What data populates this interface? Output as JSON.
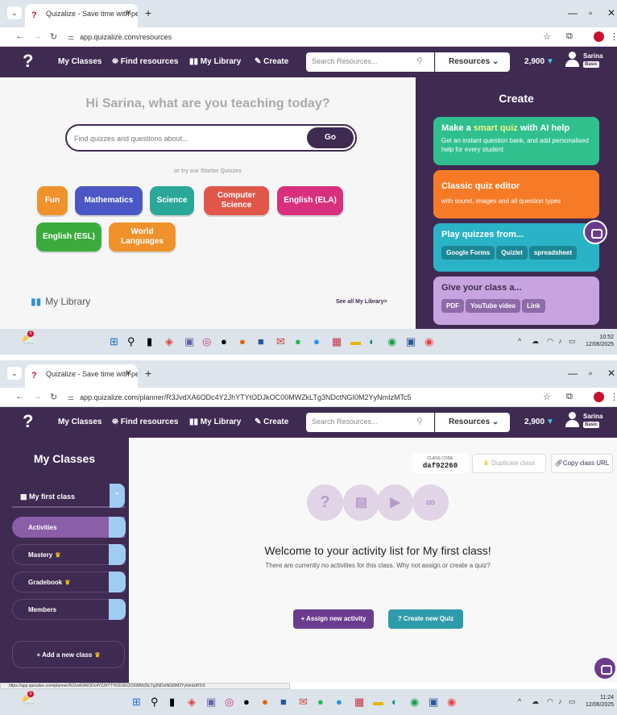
{
  "screen1": {
    "browser": {
      "tab_title": "Quizalize - Save time with pers",
      "url": "app.quizalize.com/resources"
    },
    "nav": {
      "my_classes": "My Classes",
      "find_resources": "Find resources",
      "my_library": "My Library",
      "create": "Create",
      "search_placeholder": "Search Resources...",
      "resources_label": "Resources",
      "points": "2,900",
      "user_name": "Sarina",
      "user_badge": "Basic"
    },
    "main": {
      "greeting": "Hi Sarina, what are you teaching today?",
      "search_placeholder": "Find quizzes and questions about...",
      "go_label": "Go",
      "starter_prompt": "or try our Starter Quizzes",
      "chips": [
        "Fun",
        "Mathematics",
        "Science",
        "Computer Science",
        "English (ELA)",
        "English (ESL)",
        "World Languages"
      ],
      "my_library": "My Library",
      "see_all": "See all My Library>"
    },
    "create_panel": {
      "title": "Create",
      "smart_quiz_pre": "Make a ",
      "smart_quiz_highlight": "smart quiz",
      "smart_quiz_post": " with AI help",
      "smart_quiz_sub": "Get an instant question bank, and add personalised help for every student",
      "classic_title": "Classic quiz editor",
      "classic_sub": "with sound, images and all question types",
      "play_title": "Play quizzes from...",
      "play_pills": [
        "Google Forms",
        "Quizlet",
        "spreadsheet"
      ],
      "give_title": "Give your class a...",
      "give_pills": [
        "PDF",
        "YouTube video",
        "Link"
      ]
    },
    "taskbar": {
      "time": "10:52",
      "date": "12/06/2025",
      "notif": "5"
    }
  },
  "screen2": {
    "browser": {
      "tab_title": "Quizalize - Save time with pers",
      "url": "app.quizalize.com/planner/R3JvdXA6ODc4Y2JhYTYtODJkOC00MWZkLTg3NDctNGI0M2YyNmIzMTc5"
    },
    "nav": {
      "my_classes": "My Classes",
      "find_resources": "Find resources",
      "my_library": "My Library",
      "create": "Create",
      "search_placeholder": "Search Resources...",
      "resources_label": "Resources",
      "points": "2,900",
      "user_name": "Sarina",
      "user_badge": "Basic"
    },
    "sidebar": {
      "title": "My Classes",
      "class_name": "My first class",
      "items": [
        "Activities",
        "Mastery",
        "Gradebook",
        "Members"
      ],
      "add_class": "Add a new class"
    },
    "main": {
      "class_code_label": "CLASS CODE",
      "class_code": "daf92260",
      "duplicate": "Duplicate class",
      "copy_url": "Copy class URL",
      "welcome": "Welcome to your activity list for My first class!",
      "subtext": "There are currently no activities for this class. Why not assign or create a quiz?",
      "assign": "Assign new activity",
      "create_quiz": "Create new Quiz"
    },
    "status_url": "https://app.quizalize.com/planner/R3JvdXA6ODc4Y2JhYTYtODJkOC00MWZkLTg3NDctNGI0M2YyNmIzMTc5",
    "taskbar": {
      "time": "11:24",
      "date": "12/06/2025",
      "notif": "5"
    }
  },
  "colors": {
    "brand_purple": "#3f2a52",
    "chip_orange": "#f0922b",
    "chip_blue": "#4b57c4",
    "chip_teal": "#2ba79a",
    "chip_red": "#e0574a",
    "chip_pink": "#d9307d",
    "chip_green": "#3aab3c",
    "card_green": "#2fc08e",
    "card_orange": "#f77b27",
    "card_teal": "#2ab3c6",
    "card_lilac": "#c7a4df"
  }
}
